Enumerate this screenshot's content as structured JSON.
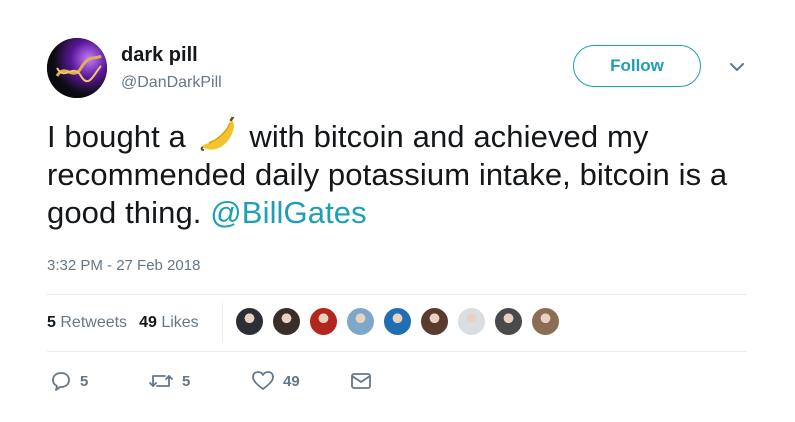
{
  "user": {
    "name": "dark pill",
    "handle": "@DanDarkPill",
    "avatar_icon": "dna-helix-avatar"
  },
  "follow_label": "Follow",
  "tweet": {
    "part1": "I bought a",
    "emoji": "banana",
    "part2": "with bitcoin and achieved my recommended daily potassium intake, bitcoin is a good thing.",
    "mention": "@BillGates"
  },
  "timestamp": "3:32 PM - 27 Feb 2018",
  "stats": {
    "retweets_count": "5",
    "retweets_label": "Retweets",
    "likes_count": "49",
    "likes_label": "Likes"
  },
  "liker_avatars": [
    {
      "color": "#2b2f36"
    },
    {
      "color": "#3a2d2a"
    },
    {
      "color": "#b3261e"
    },
    {
      "color": "#7fa7c9"
    },
    {
      "color": "#1f6fb2"
    },
    {
      "color": "#5a3b2e"
    },
    {
      "color": "#d9dee3"
    },
    {
      "color": "#4a4a4a"
    },
    {
      "color": "#8a6d52"
    }
  ],
  "actions": {
    "reply_count": "5",
    "retweet_count": "5",
    "like_count": "49"
  },
  "colors": {
    "accent": "#1da1b2",
    "secondary_text": "#657786"
  }
}
